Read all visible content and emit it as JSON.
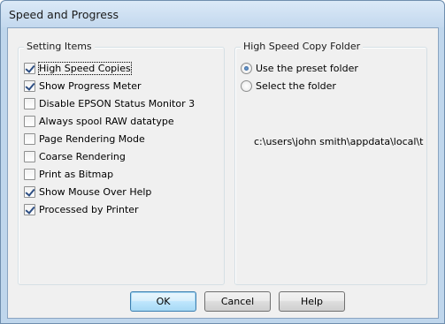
{
  "window": {
    "title": "Speed and Progress"
  },
  "setting_items": {
    "title": "Setting Items",
    "items": [
      {
        "label": "High Speed Copies",
        "checked": true,
        "focused": true
      },
      {
        "label": "Show Progress Meter",
        "checked": true
      },
      {
        "label": "Disable EPSON Status Monitor 3",
        "checked": false
      },
      {
        "label": "Always spool RAW datatype",
        "checked": false
      },
      {
        "label": "Page Rendering Mode",
        "checked": false
      },
      {
        "label": "Coarse Rendering",
        "checked": false
      },
      {
        "label": "Print as Bitmap",
        "checked": false
      },
      {
        "label": "Show Mouse Over Help",
        "checked": true
      },
      {
        "label": "Processed by Printer",
        "checked": true
      }
    ]
  },
  "copy_folder": {
    "title": "High Speed Copy Folder",
    "options": [
      {
        "label": "Use the preset folder",
        "selected": true
      },
      {
        "label": "Select the folder",
        "selected": false
      }
    ],
    "path": "c:\\users\\john smith\\appdata\\local\\temp"
  },
  "buttons": {
    "ok": "OK",
    "cancel": "Cancel",
    "help": "Help"
  }
}
